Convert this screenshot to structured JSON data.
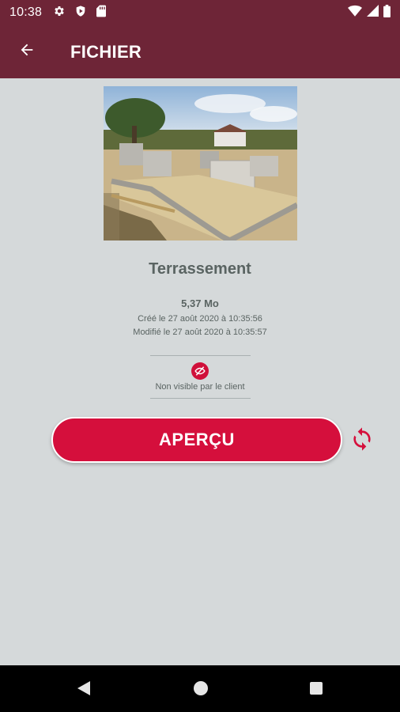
{
  "status_bar": {
    "time": "10:38",
    "left_icons": [
      "gear-icon",
      "shield-play-icon",
      "sd-card-icon"
    ],
    "right_icons": [
      "wifi-icon",
      "signal-icon",
      "battery-icon"
    ]
  },
  "app_bar": {
    "title": "FICHIER",
    "back_icon": "arrow-left-icon",
    "color": "#6e2537"
  },
  "file": {
    "name": "Terrassement",
    "size": "5,37 Mo",
    "created": "Créé le 27 août 2020 à 10:35:56",
    "modified": "Modifié le 27 août 2020 à 10:35:57",
    "visibility": "Non visible par le client",
    "visibility_icon": "eye-off-icon"
  },
  "actions": {
    "preview_label": "APERÇU",
    "sync_icon": "sync-icon",
    "accent": "#d50f3c"
  },
  "nav_bar": {
    "buttons": [
      "back-triangle-icon",
      "home-circle-icon",
      "recents-square-icon"
    ]
  }
}
